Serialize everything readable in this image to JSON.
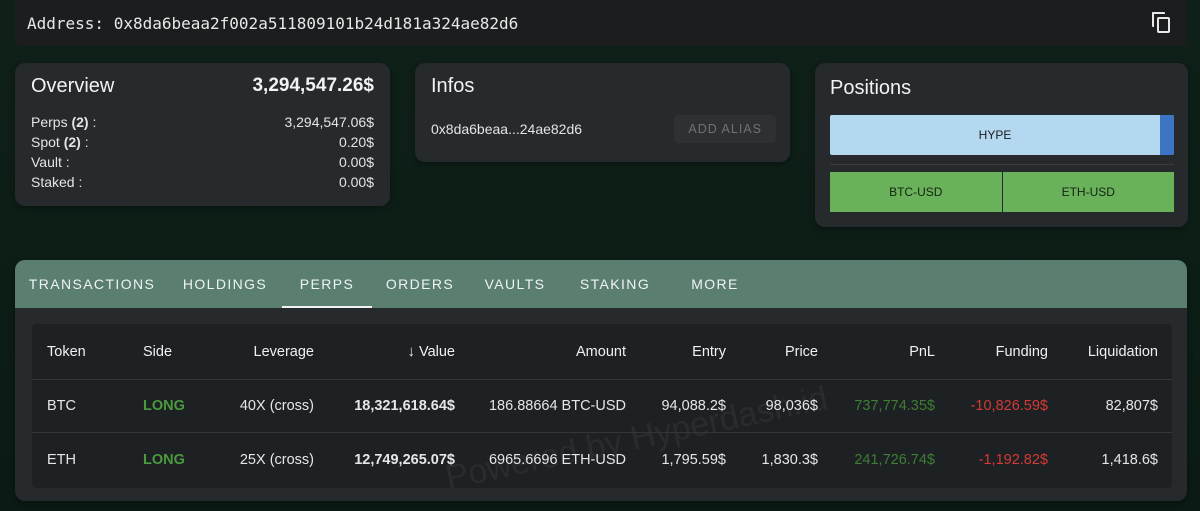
{
  "address": {
    "text": "Address: 0x8da6beaa2f002a511809101b24d181a324ae82d6",
    "copy_icon": "copy-icon"
  },
  "overview": {
    "title": "Overview",
    "total": "3,294,547.26$",
    "rows": [
      {
        "label": "Perps",
        "count": "(2)",
        "sep": " :",
        "value": "3,294,547.06$"
      },
      {
        "label": "Spot",
        "count": "(2)",
        "sep": " :",
        "value": "0.20$"
      },
      {
        "label": "Vault :",
        "count": "",
        "sep": "",
        "value": "0.00$"
      },
      {
        "label": "Staked :",
        "count": "",
        "sep": "",
        "value": "0.00$"
      }
    ]
  },
  "infos": {
    "title": "Infos",
    "short_address": "0x8da6beaa...24ae82d6",
    "alias_button": "ADD ALIAS"
  },
  "positions": {
    "title": "Positions",
    "bar1": [
      "HYPE"
    ],
    "bar2": [
      "BTC-USD",
      "ETH-USD"
    ],
    "colors": {
      "hype": "#b3d8ef",
      "edge": "#3e74c4",
      "long": "#69b25b"
    }
  },
  "tabs": [
    "TRANSACTIONS",
    "HOLDINGS",
    "PERPS",
    "ORDERS",
    "VAULTS",
    "STAKING",
    "MORE"
  ],
  "active_tab": "PERPS",
  "table": {
    "headers": [
      "Token",
      "Side",
      "Leverage",
      "Value",
      "Amount",
      "Entry",
      "Price",
      "PnL",
      "Funding",
      "Liquidation"
    ],
    "sort_icon": "arrow-down-icon",
    "rows": [
      {
        "token": "BTC",
        "side": "LONG",
        "leverage": "40X (cross)",
        "value": "18,321,618.64$",
        "amount": "186.88664 BTC-USD",
        "entry": "94,088.2$",
        "price": "98,036$",
        "pnl": "737,774.35$",
        "funding": "-10,826.59$",
        "liquidation": "82,807$"
      },
      {
        "token": "ETH",
        "side": "LONG",
        "leverage": "25X (cross)",
        "value": "12,749,265.07$",
        "amount": "6965.6696 ETH-USD",
        "entry": "1,795.59$",
        "price": "1,830.3$",
        "pnl": "241,726.74$",
        "funding": "-1,192.82$",
        "liquidation": "1,418.6$"
      }
    ],
    "watermark": "Powered by Hyperdash.id"
  }
}
